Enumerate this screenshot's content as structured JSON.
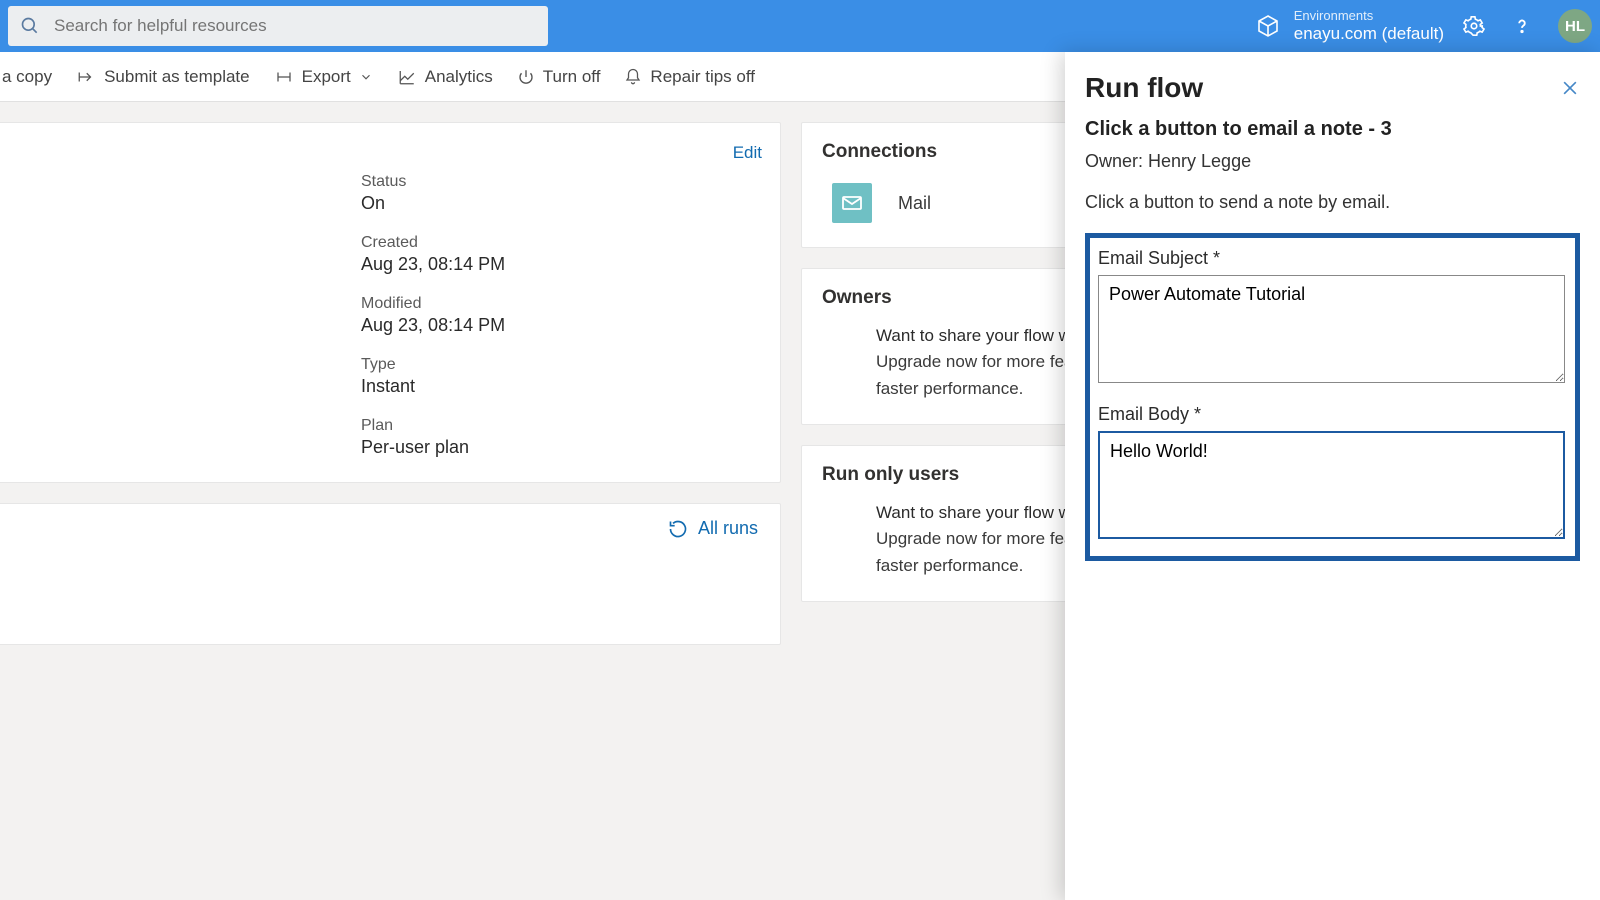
{
  "header": {
    "search_placeholder": "Search for helpful resources",
    "env_label": "Environments",
    "env_name": "enayu.com (default)",
    "avatar": "HL"
  },
  "cmdbar": {
    "copy": "a copy",
    "submit": "Submit as template",
    "export": "Export",
    "analytics": "Analytics",
    "turn_off": "Turn off",
    "repair": "Repair tips off"
  },
  "details": {
    "edit": "Edit",
    "status_label": "Status",
    "status_value": "On",
    "created_label": "Created",
    "created_value": "Aug 23, 08:14 PM",
    "modified_label": "Modified",
    "modified_value": "Aug 23, 08:14 PM",
    "type_label": "Type",
    "type_value": "Instant",
    "plan_label": "Plan",
    "plan_value": "Per-user plan",
    "all_runs": "All runs"
  },
  "right_cards": {
    "connections_title": "Connections",
    "connection_name": "Mail",
    "owners_title": "Owners",
    "runonly_title": "Run only users",
    "share_line1": "Want to share your flow w",
    "share_line2": "Upgrade now for more feat",
    "share_line3": "faster performance."
  },
  "panel": {
    "title": "Run flow",
    "subtitle": "Click a button to email a note - 3",
    "owner": "Owner: Henry Legge",
    "desc": "Click a button to send a note by email.",
    "subject_label": "Email Subject *",
    "subject_value": "Power Automate Tutorial",
    "body_label": "Email Body *",
    "body_value": "Hello World!"
  }
}
